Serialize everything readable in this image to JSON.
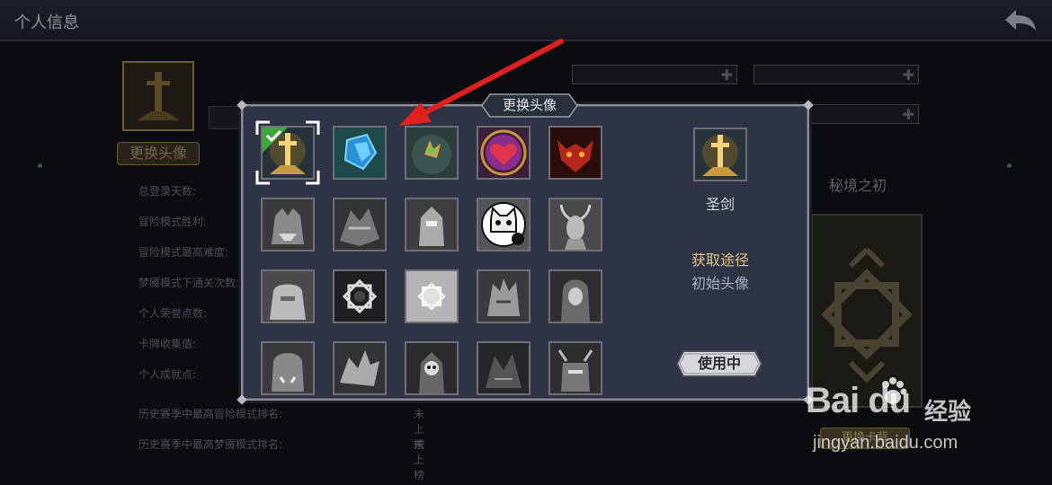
{
  "header": {
    "title": "个人信息"
  },
  "background": {
    "change_avatar_label": "更换头像",
    "stats": [
      {
        "label": "总登录天数:",
        "value": ""
      },
      {
        "label": "冒险模式胜利:",
        "value": ""
      },
      {
        "label": "冒险模式最高难度:",
        "value": ""
      },
      {
        "label": "梦魇模式下通关次数:",
        "value": ""
      },
      {
        "label": "个人荣誉点数:",
        "value": ""
      },
      {
        "label": "卡牌收集值:",
        "value": ""
      },
      {
        "label": "个人成就点:",
        "value": ""
      },
      {
        "label": "历史赛季中最高冒险模式排名:",
        "value": "未上榜"
      },
      {
        "label": "历史赛季中最高梦魇模式排名:",
        "value": "未上榜"
      }
    ],
    "realm_title": "秘境之初",
    "card_button_label": "更换卡背"
  },
  "modal": {
    "title": "更换头像",
    "selected": {
      "name": "圣剑",
      "acquire_title": "获取途径",
      "acquire_value": "初始头像",
      "button_label": "使用中"
    },
    "avatars": [
      {
        "name": "holy-sword",
        "unlocked": true,
        "selected": true
      },
      {
        "name": "blue-crystal",
        "unlocked": true,
        "selected": false
      },
      {
        "name": "golden-flower",
        "unlocked": true,
        "selected": false
      },
      {
        "name": "heart-flame",
        "unlocked": true,
        "selected": false
      },
      {
        "name": "red-demon",
        "unlocked": true,
        "selected": false
      },
      {
        "name": "werewolf",
        "unlocked": false,
        "selected": false
      },
      {
        "name": "dragon-beast",
        "unlocked": false,
        "selected": false
      },
      {
        "name": "golem",
        "unlocked": false,
        "selected": false
      },
      {
        "name": "cat",
        "unlocked": false,
        "selected": false
      },
      {
        "name": "horned-woman",
        "unlocked": false,
        "selected": false
      },
      {
        "name": "yeti",
        "unlocked": false,
        "selected": false
      },
      {
        "name": "dark-sigil",
        "unlocked": false,
        "selected": false
      },
      {
        "name": "light-sigil",
        "unlocked": false,
        "selected": false
      },
      {
        "name": "wolf-warrior",
        "unlocked": false,
        "selected": false
      },
      {
        "name": "hooded-figure",
        "unlocked": false,
        "selected": false
      },
      {
        "name": "orc",
        "unlocked": false,
        "selected": false
      },
      {
        "name": "dragon-head",
        "unlocked": false,
        "selected": false
      },
      {
        "name": "skeleton-knight",
        "unlocked": false,
        "selected": false
      },
      {
        "name": "dark-dragon",
        "unlocked": false,
        "selected": false
      },
      {
        "name": "demon-beast",
        "unlocked": false,
        "selected": false
      }
    ]
  },
  "watermark": {
    "brand": "Bai du",
    "cn": "经验",
    "url": "jingyan.baidu.com"
  },
  "colors": {
    "gold": "#e1c57b",
    "accent_red": "#e0201c",
    "panel": "#2e3445",
    "check_green": "#3fa63b"
  }
}
